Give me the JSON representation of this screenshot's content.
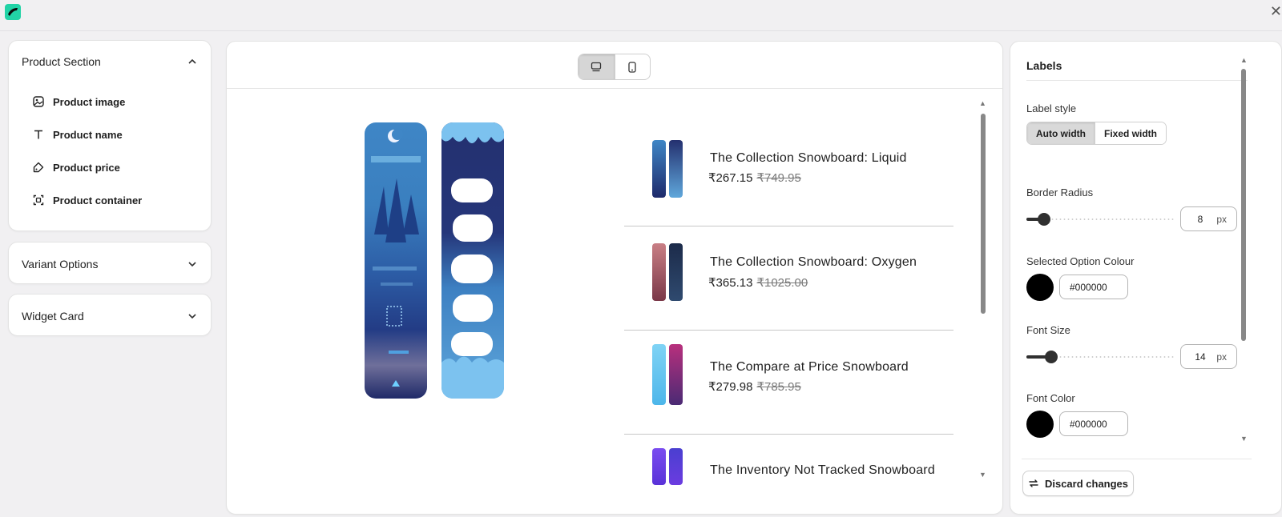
{
  "window": {
    "close_glyph": "✕",
    "logo_icon": "app-logo-icon"
  },
  "left_panel": {
    "product_section": {
      "title": "Product Section",
      "items": [
        {
          "label": "Product image",
          "icon": "image-icon"
        },
        {
          "label": "Product name",
          "icon": "text-icon"
        },
        {
          "label": "Product price",
          "icon": "price-tag-icon"
        },
        {
          "label": "Product container",
          "icon": "container-icon"
        }
      ]
    },
    "variant_options": {
      "title": "Variant Options"
    },
    "widget_card": {
      "title": "Widget Card"
    }
  },
  "preview": {
    "view_modes": [
      {
        "name": "desktop",
        "icon": "desktop-icon",
        "active": true
      },
      {
        "name": "mobile",
        "icon": "mobile-icon",
        "active": false
      }
    ],
    "products": [
      {
        "name": "The Collection Snowboard: Liquid",
        "price": "₹267.15",
        "compare_price": "₹749.95",
        "colors": [
          "#2f5fa8",
          "#1d2a6e"
        ]
      },
      {
        "name": "The Collection Snowboard: Oxygen",
        "price": "₹365.13",
        "compare_price": "₹1025.00",
        "colors": [
          "#b06a70",
          "#1c2b4a"
        ]
      },
      {
        "name": "The Compare at Price Snowboard",
        "price": "₹279.98",
        "compare_price": "₹785.95",
        "colors": [
          "#5ec6ef",
          "#7a2b78"
        ]
      },
      {
        "name": "The Inventory Not Tracked Snowboard",
        "price": "",
        "compare_price": "",
        "colors": [
          "#6a3be0",
          "#3d2fb8"
        ]
      }
    ]
  },
  "settings": {
    "title": "Labels",
    "label_style": {
      "label": "Label style",
      "options": [
        "Auto width",
        "Fixed width"
      ],
      "selected": "Auto width"
    },
    "border_radius": {
      "label": "Border Radius",
      "value": "8",
      "unit": "px",
      "slider_fraction": 0.12
    },
    "selected_option_colour": {
      "label": "Selected Option Colour",
      "value": "#000000"
    },
    "font_size": {
      "label": "Font Size",
      "value": "14",
      "unit": "px",
      "slider_fraction": 0.17
    },
    "font_color": {
      "label": "Font Color",
      "value": "#000000"
    },
    "discard_label": "Discard changes"
  },
  "colors": {
    "accent": "#22d3a6",
    "board_dark": "#1e2a6b",
    "board_light": "#6fb7e3"
  }
}
